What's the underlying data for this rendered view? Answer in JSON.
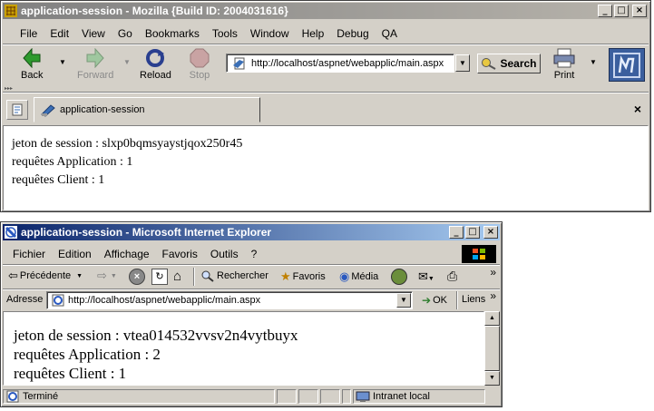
{
  "mozilla": {
    "title": "application-session - Mozilla {Build ID: 2004031616}",
    "menu": [
      "File",
      "Edit",
      "View",
      "Go",
      "Bookmarks",
      "Tools",
      "Window",
      "Help",
      "Debug",
      "QA"
    ],
    "toolbar": {
      "back": "Back",
      "forward": "Forward",
      "reload": "Reload",
      "stop": "Stop",
      "search": "Search",
      "print": "Print"
    },
    "url": "http://localhost/aspnet/webapplic/main.aspx",
    "tab_label": "application-session",
    "content": {
      "line1": "jeton de session : slxp0bqmsyaystjqox250r45",
      "line2": "requêtes Application : 1",
      "line3": "requêtes Client : 1"
    }
  },
  "ie": {
    "title": "application-session - Microsoft Internet Explorer",
    "menu": [
      "Fichier",
      "Edition",
      "Affichage",
      "Favoris",
      "Outils",
      "?"
    ],
    "toolbar": {
      "back": "Précédente",
      "search": "Rechercher",
      "favorites": "Favoris",
      "media": "Média"
    },
    "address_label": "Adresse",
    "url": "http://localhost/aspnet/webapplic/main.aspx",
    "go": "OK",
    "links": "Liens",
    "chevron": "»",
    "content": {
      "line1": "jeton de session : vtea014532vvsv2n4vytbuyx",
      "line2": "requêtes Application : 2",
      "line3": "requêtes Client : 1"
    },
    "status": {
      "text": "Terminé",
      "zone": "Intranet local"
    }
  }
}
